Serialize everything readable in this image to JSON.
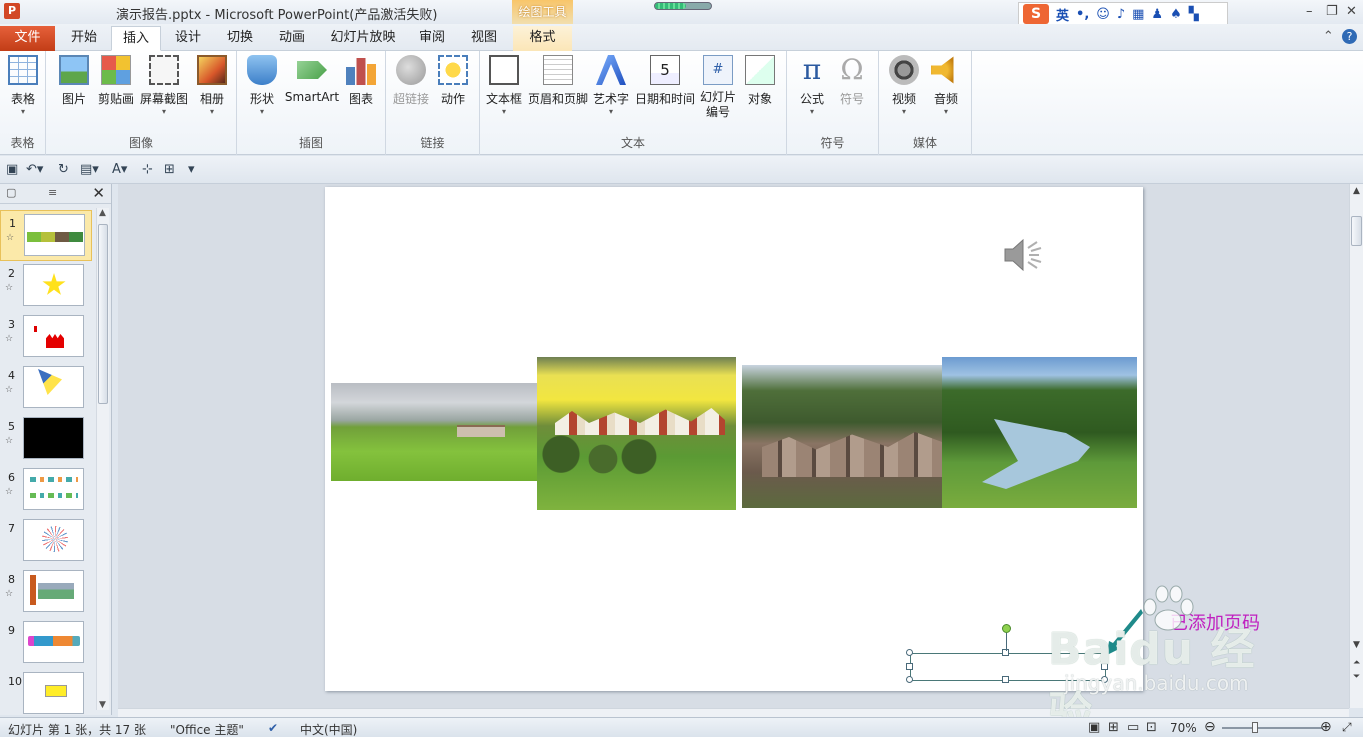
{
  "titlebar": {
    "doc_title": "演示报告.pptx  -  Microsoft PowerPoint(产品激活失败)",
    "app_icon": "P",
    "contextual_group": "绘图工具",
    "ime": {
      "logo": "S",
      "lang": "英",
      "items": [
        "smiley-icon",
        "mic-icon",
        "keyboard-icon",
        "user-icon",
        "shirt-icon",
        "grid-icon"
      ]
    },
    "window_controls": {
      "minimize": "–",
      "restore": "❐",
      "close": "✕"
    },
    "progress_fraction": 0.55
  },
  "tabs": {
    "file": "文件",
    "items": [
      "开始",
      "插入",
      "设计",
      "切换",
      "动画",
      "幻灯片放映",
      "审阅",
      "视图",
      "格式"
    ],
    "active": "插入",
    "collapse": "⌃",
    "help": "?"
  },
  "ribbon": {
    "groups": {
      "tables": {
        "label": "表格",
        "buttons": [
          "表格"
        ]
      },
      "images": {
        "label": "图像",
        "buttons": [
          "图片",
          "剪贴画",
          "屏幕截图",
          "相册"
        ]
      },
      "illustrations": {
        "label": "插图",
        "buttons": [
          "形状",
          "SmartArt",
          "图表"
        ]
      },
      "links": {
        "label": "链接",
        "buttons": [
          "超链接",
          "动作"
        ]
      },
      "text": {
        "label": "文本",
        "buttons": [
          "文本框",
          "页眉和页脚",
          "艺术字",
          "日期和时间",
          "幻灯片编号",
          "对象"
        ],
        "slide_number_lines": [
          "幻灯片",
          "编号"
        ]
      },
      "symbols": {
        "label": "符号",
        "buttons": [
          "公式",
          "符号"
        ]
      },
      "media": {
        "label": "媒体",
        "buttons": [
          "视频",
          "音频"
        ]
      }
    },
    "date_icon_digit": "5"
  },
  "qat": [
    "save-icon",
    "undo-icon",
    "redo-icon",
    "layout-icon",
    "font-icon",
    "align-icon",
    "distribute-icon",
    "customize-icon"
  ],
  "left_pane": {
    "tabs": [
      "slides-tab",
      "outline-tab"
    ],
    "close": "✕",
    "slides": [
      {
        "num": "1",
        "star": "☆",
        "selected": true
      },
      {
        "num": "2",
        "star": "☆"
      },
      {
        "num": "3",
        "star": "☆"
      },
      {
        "num": "4",
        "star": "☆"
      },
      {
        "num": "5",
        "star": "☆"
      },
      {
        "num": "6",
        "star": "☆"
      },
      {
        "num": "7",
        "star": ""
      },
      {
        "num": "8",
        "star": "☆"
      },
      {
        "num": "9",
        "star": ""
      },
      {
        "num": "10",
        "star": ""
      }
    ]
  },
  "slide": {
    "photos": [
      "grassland-photo",
      "village-rapeseed-photo",
      "mountain-village-photo",
      "river-valley-photo"
    ]
  },
  "statusbar": {
    "slide_info": "幻灯片 第 1 张，共 17 张",
    "theme": "\"Office 主题\"",
    "language": "中文(中国)",
    "zoom": "70%",
    "zoom_fraction": 0.3
  },
  "overlay": {
    "page_number_hint": "已添加页码",
    "watermark_main": "Baidu 经验",
    "watermark_url": "jingyan.baidu.com"
  }
}
